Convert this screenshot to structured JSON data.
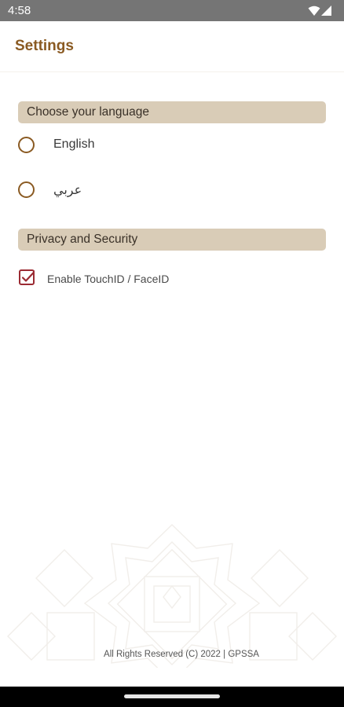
{
  "status_bar": {
    "time": "4:58",
    "icons": [
      "wifi-icon",
      "cellular-signal-icon"
    ]
  },
  "header": {
    "title": "Settings"
  },
  "language_section": {
    "title": "Choose your language",
    "options": [
      {
        "label": "English",
        "selected": false
      },
      {
        "label": "عربي",
        "selected": false
      }
    ]
  },
  "privacy_section": {
    "title": "Privacy and Security",
    "touchid": {
      "label": "Enable TouchID / FaceID",
      "checked": true
    }
  },
  "footer": {
    "text": "All Rights Reserved (C) 2022  | GPSSA"
  },
  "colors": {
    "accent": "#8a5a22",
    "section_bg": "#d9ccb7",
    "checkbox": "#9b2b33",
    "status_bar": "#757575"
  }
}
